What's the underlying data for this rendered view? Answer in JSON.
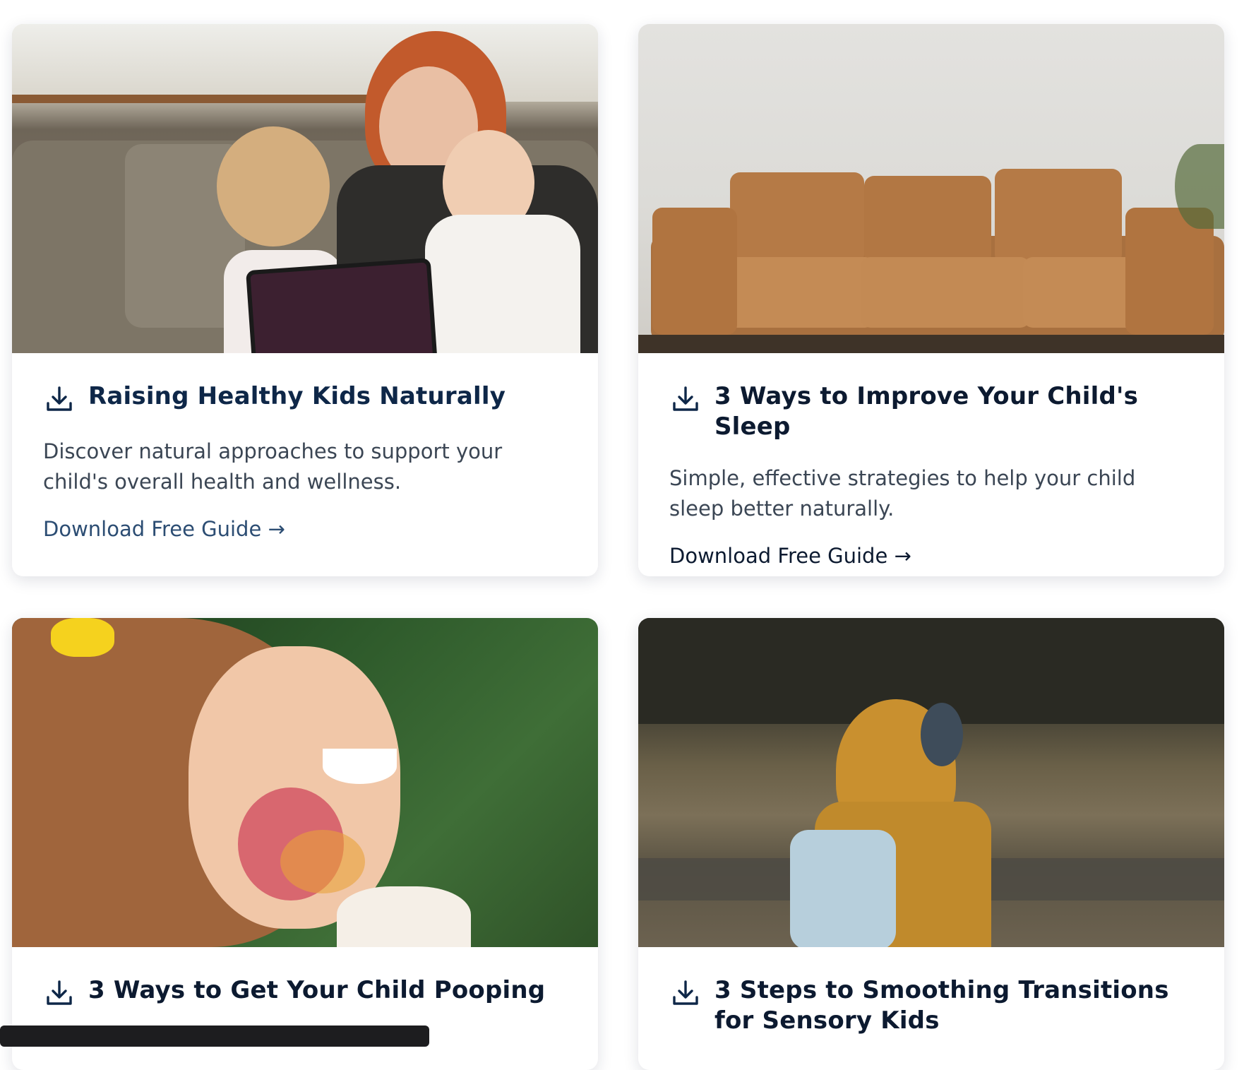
{
  "cards": [
    {
      "image_alt": "Mother with toddler and baby looking at a tablet on a couch",
      "title": "Raising Healthy Kids Naturally",
      "description": "Discover natural approaches to support your child's overall health and wellness.",
      "cta": "Download Free Guide →"
    },
    {
      "image_alt": "Tan leather sofa against a white wall",
      "title": "3 Ways to Improve Your Child's Sleep",
      "description": "Simple, effective strategies to help your child sleep better naturally.",
      "cta": "Download Free Guide →"
    },
    {
      "image_alt": "Smiling girl with paint on her face",
      "title": "3 Ways to Get Your Child Pooping"
    },
    {
      "image_alt": "Child in yellow raincoat with backpack outdoors",
      "title": "3 Steps to Smoothing Transitions for Sensory Kids"
    }
  ],
  "icons": {
    "download": "download-icon"
  },
  "colors": {
    "title": "#0e2748",
    "link": "#2c4d73",
    "text": "#3b4654"
  }
}
